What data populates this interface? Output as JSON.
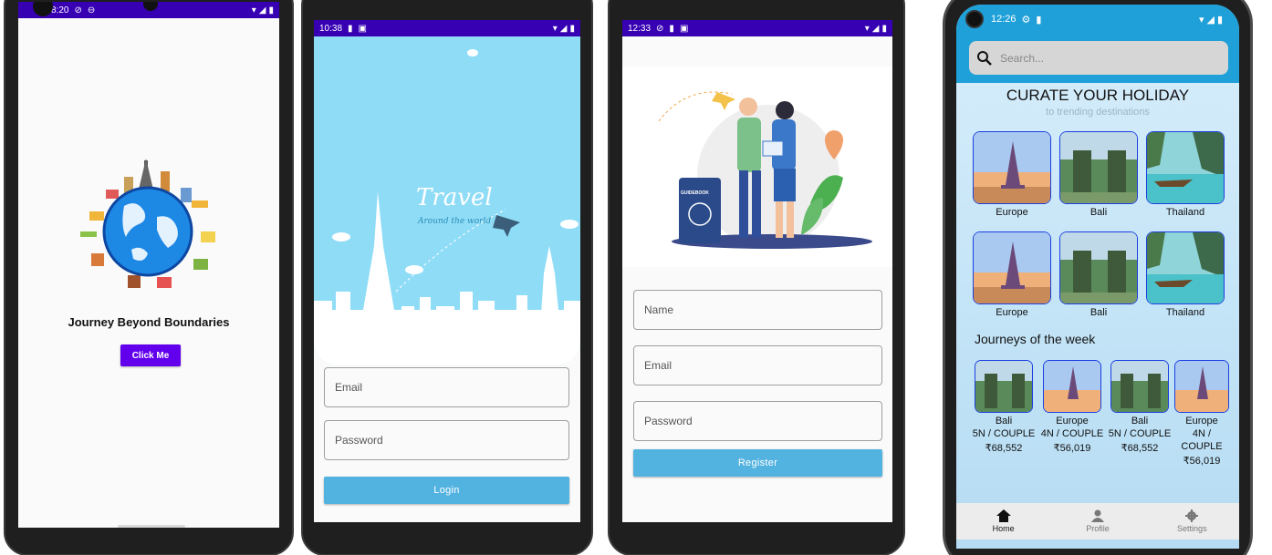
{
  "screen1": {
    "status_time": "8:20",
    "tagline": "Journey Beyond Boundaries",
    "button_label": "Click Me",
    "accent": "#6200ee"
  },
  "screen2": {
    "status_time": "10:38",
    "logo_title": "Travel",
    "logo_subtitle": "Around the world",
    "email_placeholder": "Email",
    "password_placeholder": "Password",
    "login_label": "Login"
  },
  "screen3": {
    "status_time": "12:33",
    "guidebook_text": "GUIDEBOOK",
    "name_placeholder": "Name",
    "email_placeholder": "Email",
    "password_placeholder": "Password",
    "register_label": "Register"
  },
  "screen4": {
    "status_time": "12:26",
    "search_placeholder": "Search...",
    "title": "CURATE YOUR HOLIDAY",
    "subtitle": "to trending destinations",
    "destinations_row1": [
      "Europe",
      "Bali",
      "Thailand"
    ],
    "destinations_row2": [
      "Europe",
      "Bali",
      "Thailand"
    ],
    "weekly_heading": "Journeys of the week",
    "weekly": [
      {
        "name": "Bali",
        "duration": "5N / COUPLE",
        "price": "₹68,552"
      },
      {
        "name": "Europe",
        "duration": "4N / COUPLE",
        "price": "₹56,019"
      },
      {
        "name": "Bali",
        "duration": "5N / COUPLE",
        "price": "₹68,552"
      },
      {
        "name": "Europe",
        "duration": "4N / COUPLE",
        "price": "₹56,019"
      }
    ],
    "nav": [
      "Home",
      "Profile",
      "Settings"
    ]
  },
  "colors": {
    "primary_purple": "#6200ee",
    "status_purple": "#3700b3",
    "sky_blue": "#8fdcf7",
    "button_blue": "#53b3e0",
    "card_border": "#1a3fe0"
  }
}
